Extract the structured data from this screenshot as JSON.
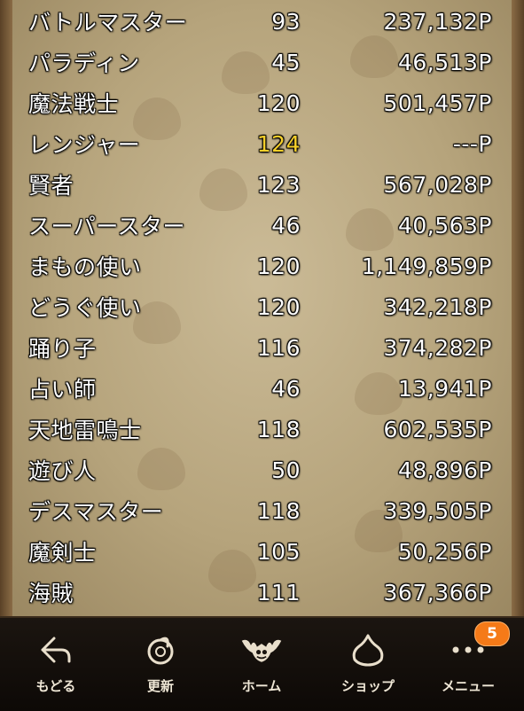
{
  "jobs": [
    {
      "name": "バトルマスター",
      "level": "93",
      "points": "237,132P"
    },
    {
      "name": "パラディン",
      "level": "45",
      "points": "46,513P"
    },
    {
      "name": "魔法戦士",
      "level": "120",
      "points": "501,457P"
    },
    {
      "name": "レンジャー",
      "level": "124",
      "points": "---P",
      "level_color": "#f6cf2a"
    },
    {
      "name": "賢者",
      "level": "123",
      "points": "567,028P"
    },
    {
      "name": "スーパースター",
      "level": "46",
      "points": "40,563P"
    },
    {
      "name": "まもの使い",
      "level": "120",
      "points": "1,149,859P"
    },
    {
      "name": "どうぐ使い",
      "level": "120",
      "points": "342,218P"
    },
    {
      "name": "踊り子",
      "level": "116",
      "points": "374,282P"
    },
    {
      "name": "占い師",
      "level": "46",
      "points": "13,941P"
    },
    {
      "name": "天地雷鳴士",
      "level": "118",
      "points": "602,535P"
    },
    {
      "name": "遊び人",
      "level": "50",
      "points": "48,896P"
    },
    {
      "name": "デスマスター",
      "level": "118",
      "points": "339,505P"
    },
    {
      "name": "魔剣士",
      "level": "105",
      "points": "50,256P"
    },
    {
      "name": "海賊",
      "level": "111",
      "points": "367,366P"
    }
  ],
  "nav": {
    "back": {
      "label": "もどる",
      "icon": "back-arrow-icon"
    },
    "refresh": {
      "label": "更新",
      "icon": "refresh-icon"
    },
    "home": {
      "label": "ホーム",
      "icon": "dracky-bat-icon"
    },
    "shop": {
      "label": "ショップ",
      "icon": "slime-icon"
    },
    "menu": {
      "label": "メニュー",
      "icon": "more-dots-icon",
      "badge": "5"
    }
  },
  "colors": {
    "highlight": "#f6cf2a",
    "badge": "#f57a18",
    "panel": "#bfae88"
  }
}
